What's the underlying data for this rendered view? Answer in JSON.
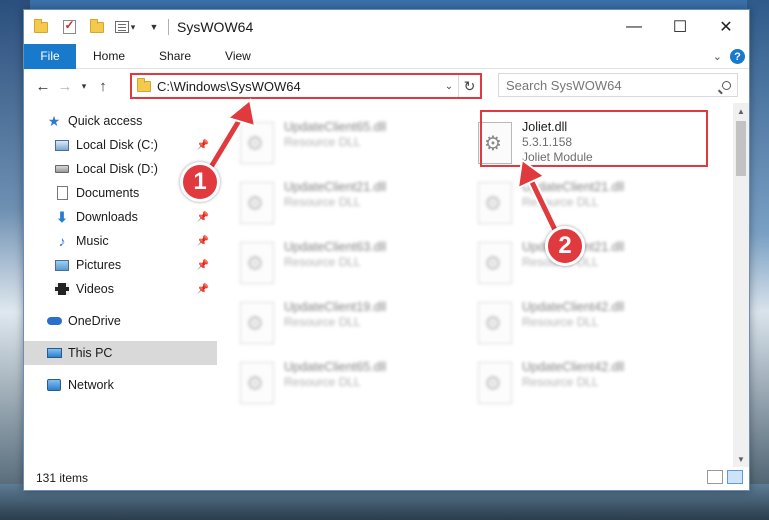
{
  "window": {
    "title": "SysWOW64"
  },
  "title_controls": {
    "minimize": "—",
    "maximize": "☐",
    "close": "✕"
  },
  "ribbon": {
    "tabs": [
      "File",
      "Home",
      "Share",
      "View"
    ],
    "help": "?"
  },
  "address": {
    "path": "C:\\Windows\\SysWOW64",
    "search_placeholder": "Search SysWOW64"
  },
  "nav": {
    "items": [
      {
        "label": "Quick access",
        "icon": "star-icon",
        "pinned": false
      },
      {
        "label": "Local Disk (C:)",
        "icon": "drive-icon",
        "pinned": true
      },
      {
        "label": "Local Disk (D:)",
        "icon": "drive-icon",
        "pinned": false
      },
      {
        "label": "Documents",
        "icon": "documents-icon",
        "pinned": true
      },
      {
        "label": "Downloads",
        "icon": "downloads-icon",
        "pinned": true
      },
      {
        "label": "Music",
        "icon": "music-icon",
        "pinned": true
      },
      {
        "label": "Pictures",
        "icon": "pictures-icon",
        "pinned": true
      },
      {
        "label": "Videos",
        "icon": "videos-icon",
        "pinned": true
      },
      {
        "label": "OneDrive",
        "icon": "onedrive-icon",
        "pinned": false
      },
      {
        "label": "This PC",
        "icon": "this-pc-icon",
        "pinned": false,
        "selected": true
      },
      {
        "label": "Network",
        "icon": "network-icon",
        "pinned": false
      }
    ]
  },
  "files": {
    "highlighted": {
      "name": "Joliet.dll",
      "version": "5.3.1.158",
      "description": "Joliet Module"
    },
    "blurred": [
      {
        "name": "UpdateClient65.dll",
        "type": "Resource DLL"
      },
      {
        "name": "UpdateClient21.dll",
        "type": "Resource DLL"
      },
      {
        "name": "UpdateClient21.dll",
        "type": "Resource DLL"
      },
      {
        "name": "UpdateClient63.dll",
        "type": "Resource DLL"
      },
      {
        "name": "UpdateClient21.dll",
        "type": "Resource DLL"
      },
      {
        "name": "UpdateClient19.dll",
        "type": "Resource DLL"
      },
      {
        "name": "UpdateClient42.dll",
        "type": "Resource DLL"
      },
      {
        "name": "UpdateClient65.dll",
        "type": "Resource DLL"
      },
      {
        "name": "UpdateClient42.dll",
        "type": "Resource DLL"
      }
    ]
  },
  "status": {
    "item_count": "131 items"
  },
  "callouts": {
    "step1": "1",
    "step2": "2"
  },
  "colors": {
    "accent": "#1979ca",
    "callout_red": "#e0393e"
  }
}
